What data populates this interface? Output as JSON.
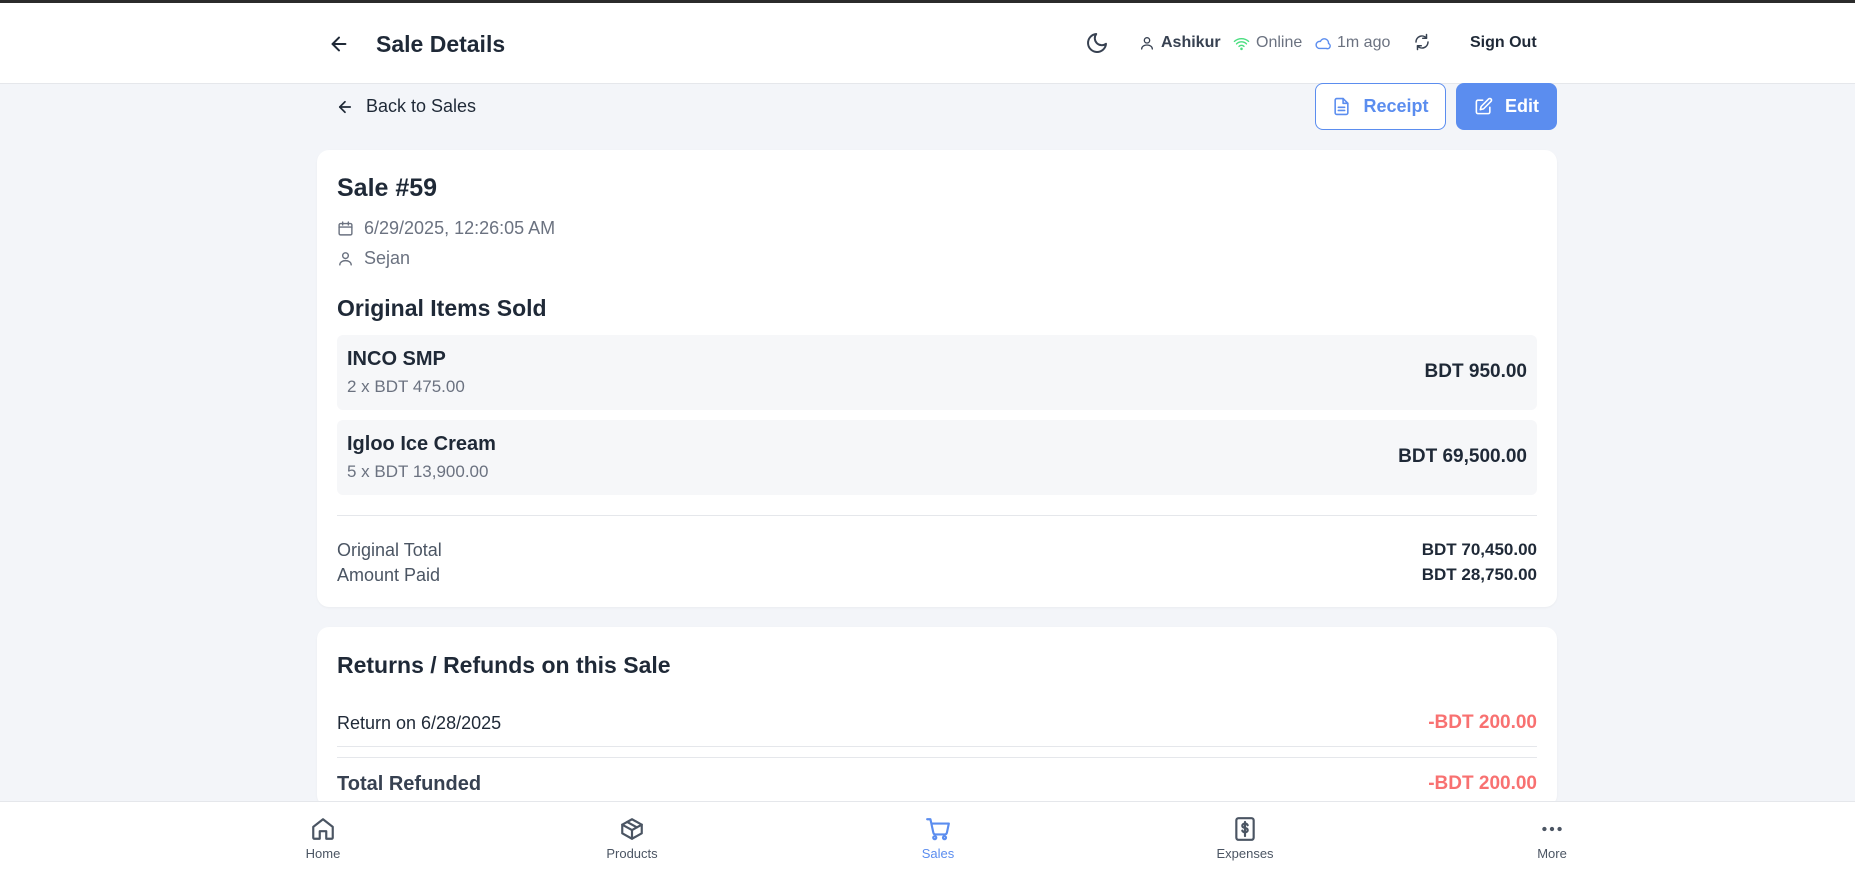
{
  "header": {
    "title": "Sale Details",
    "user": "Ashikur",
    "connection": "Online",
    "last_sync": "1m ago",
    "sign_out": "Sign Out"
  },
  "toolbar": {
    "back_label": "Back to Sales",
    "receipt_label": "Receipt",
    "edit_label": "Edit"
  },
  "sale": {
    "title": "Sale #59",
    "date": "6/29/2025, 12:26:05 AM",
    "customer": "Sejan",
    "items_heading": "Original Items Sold",
    "items": [
      {
        "name": "INCO SMP",
        "qty_price": "2 x BDT 475.00",
        "total": "BDT 950.00"
      },
      {
        "name": "Igloo Ice Cream",
        "qty_price": "5 x BDT 13,900.00",
        "total": "BDT 69,500.00"
      }
    ],
    "original_total_label": "Original Total",
    "original_total": "BDT 70,450.00",
    "amount_paid_label": "Amount Paid",
    "amount_paid": "BDT 28,750.00"
  },
  "returns": {
    "heading": "Returns / Refunds on this Sale",
    "entries": [
      {
        "label": "Return on 6/28/2025",
        "amount": "-BDT 200.00"
      }
    ],
    "total_label": "Total Refunded",
    "total_amount": "-BDT 200.00"
  },
  "nav": {
    "items": [
      {
        "label": "Home",
        "icon": "home-icon"
      },
      {
        "label": "Products",
        "icon": "box-icon"
      },
      {
        "label": "Sales",
        "icon": "cart-icon",
        "active": true
      },
      {
        "label": "Expenses",
        "icon": "dollar-receipt-icon"
      },
      {
        "label": "More",
        "icon": "more-dots-icon"
      }
    ]
  },
  "colors": {
    "accent": "#5b8def",
    "refund": "#f87171",
    "online": "#4ade80",
    "background": "#f3f5f9"
  }
}
